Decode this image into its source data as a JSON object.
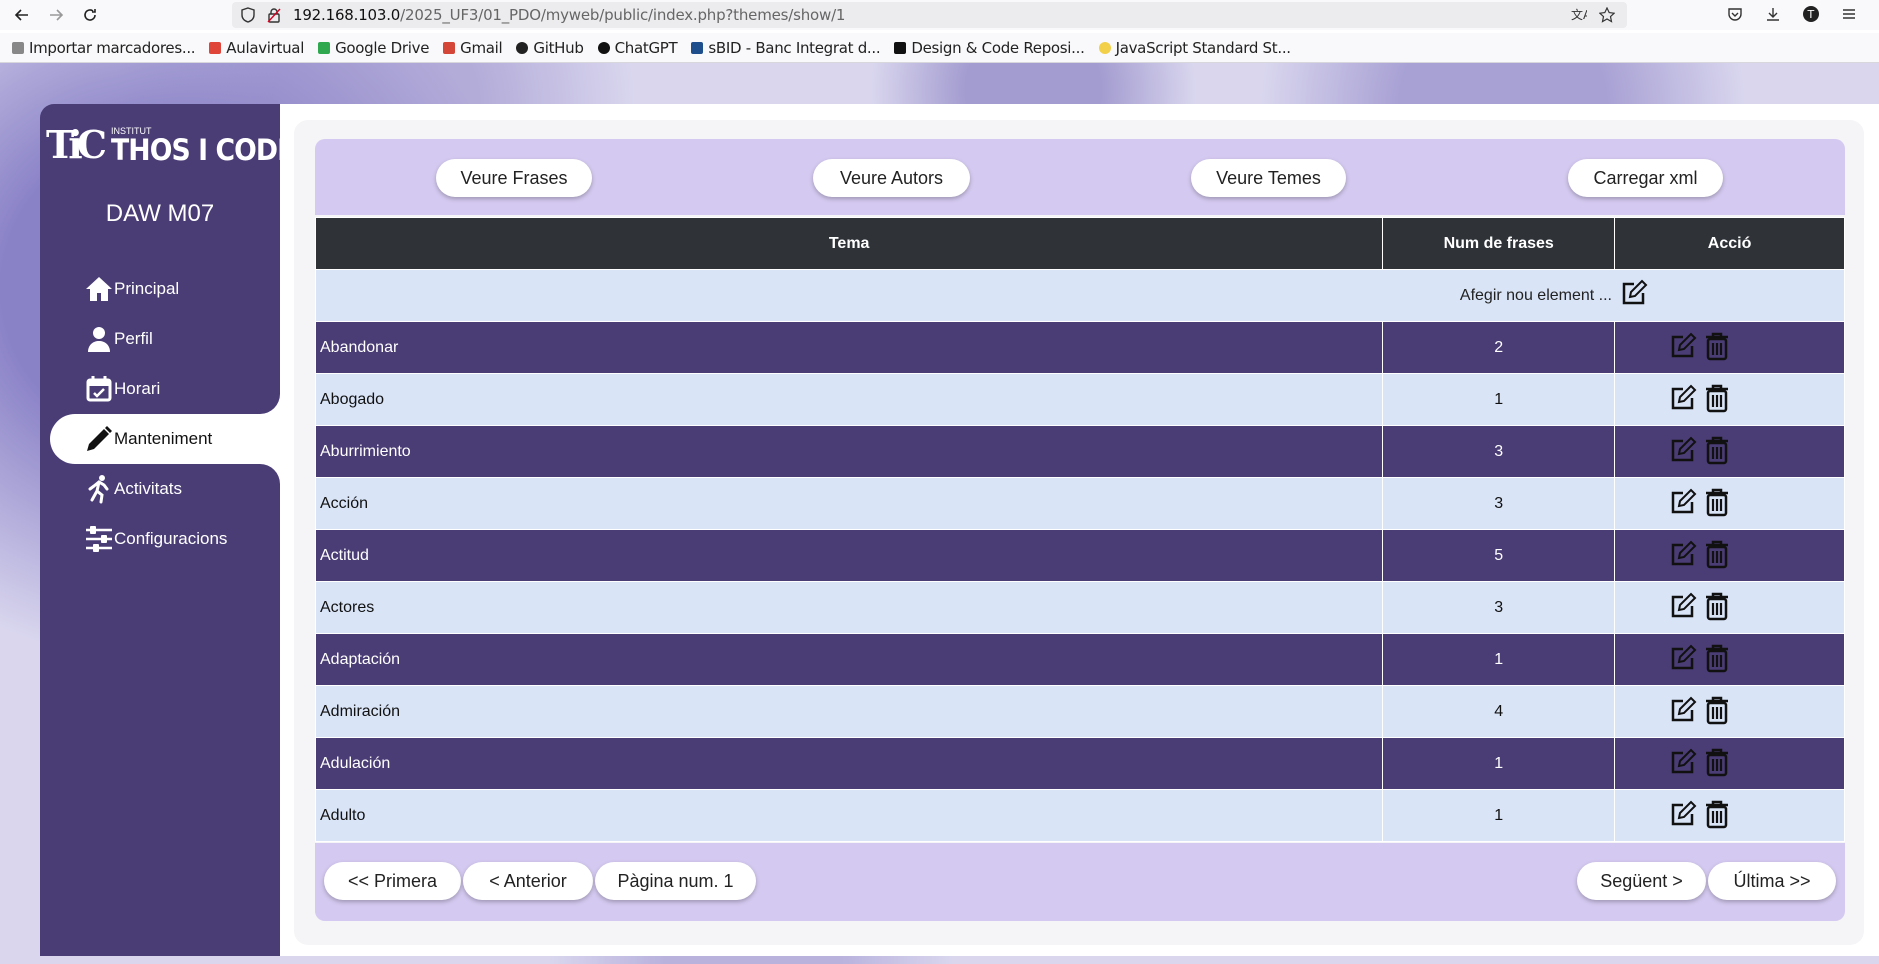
{
  "browser": {
    "url_host": "192.168.103.0",
    "url_path": "/2025_UF3/01_PDO/myweb/public/index.php?themes/show/1",
    "bookmarks": [
      "Importar marcadores...",
      "Aulavirtual",
      "Google Drive",
      "Gmail",
      "GitHub",
      "ChatGPT",
      "sBID - Banc Integrat d...",
      "Design & Code Reposi...",
      "JavaScript Standard St..."
    ]
  },
  "sidebar": {
    "logo_small": "INSTITUT",
    "logo_big": "THOS I CODINA",
    "logo_mark": "TiC",
    "course": "DAW M07",
    "items": [
      {
        "label": "Principal",
        "icon": "home-icon"
      },
      {
        "label": "Perfil",
        "icon": "user-icon"
      },
      {
        "label": "Horari",
        "icon": "calendar-icon"
      },
      {
        "label": "Manteniment",
        "icon": "pencil-icon"
      },
      {
        "label": "Activitats",
        "icon": "running-icon"
      },
      {
        "label": "Configuracions",
        "icon": "sliders-icon"
      }
    ],
    "active": "Manteniment"
  },
  "toolbar": {
    "frases": "Veure Frases",
    "autors": "Veure Autors",
    "temes": "Veure Temes",
    "xml": "Carregar xml"
  },
  "table": {
    "headers": {
      "tema": "Tema",
      "num": "Num de frases",
      "accio": "Acció"
    },
    "add_label": "Afegir nou element ...",
    "rows": [
      {
        "tema": "Abandonar",
        "num": "2"
      },
      {
        "tema": "Abogado",
        "num": "1"
      },
      {
        "tema": "Aburrimiento",
        "num": "3"
      },
      {
        "tema": "Acción",
        "num": "3"
      },
      {
        "tema": "Actitud",
        "num": "5"
      },
      {
        "tema": "Actores",
        "num": "3"
      },
      {
        "tema": "Adaptación",
        "num": "1"
      },
      {
        "tema": "Admiración",
        "num": "4"
      },
      {
        "tema": "Adulación",
        "num": "1"
      },
      {
        "tema": "Adulto",
        "num": "1"
      }
    ]
  },
  "pagination": {
    "first": "<< Primera",
    "prev": "< Anterior",
    "page": "Pàgina num. 1",
    "next": "Següent >",
    "last": "Última >>"
  }
}
